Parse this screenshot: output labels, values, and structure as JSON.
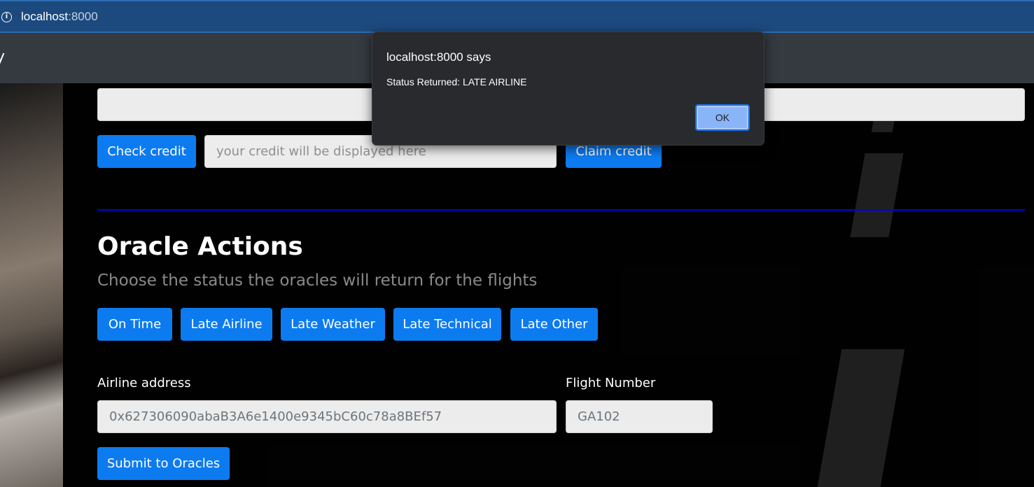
{
  "browser": {
    "url_host": "localhost",
    "url_port": ":8000"
  },
  "navbar": {
    "brand_fragment": "y"
  },
  "credit": {
    "check_button": "Check credit",
    "credit_placeholder": "your credit will be displayed here",
    "claim_button": "Claim credit"
  },
  "oracle": {
    "title": "Oracle Actions",
    "subtitle": "Choose the status the oracles will return for the flights",
    "status_buttons": [
      "On Time",
      "Late Airline",
      "Late Weather",
      "Late Technical",
      "Late Other"
    ],
    "airline_label": "Airline address",
    "airline_value": "0x627306090abaB3A6e1400e9345bC60c78a8BEf57",
    "flight_label": "Flight Number",
    "flight_value": "GA102",
    "submit_button": "Submit to Oracles"
  },
  "dialog": {
    "title": "localhost:8000 says",
    "message": "Status Returned: LATE AIRLINE",
    "ok_label": "OK"
  },
  "colors": {
    "primary": "#0d7bf0",
    "divider": "#0000ff",
    "dialog_bg": "#292a2d",
    "dialog_ok": "#8ab4f8"
  }
}
